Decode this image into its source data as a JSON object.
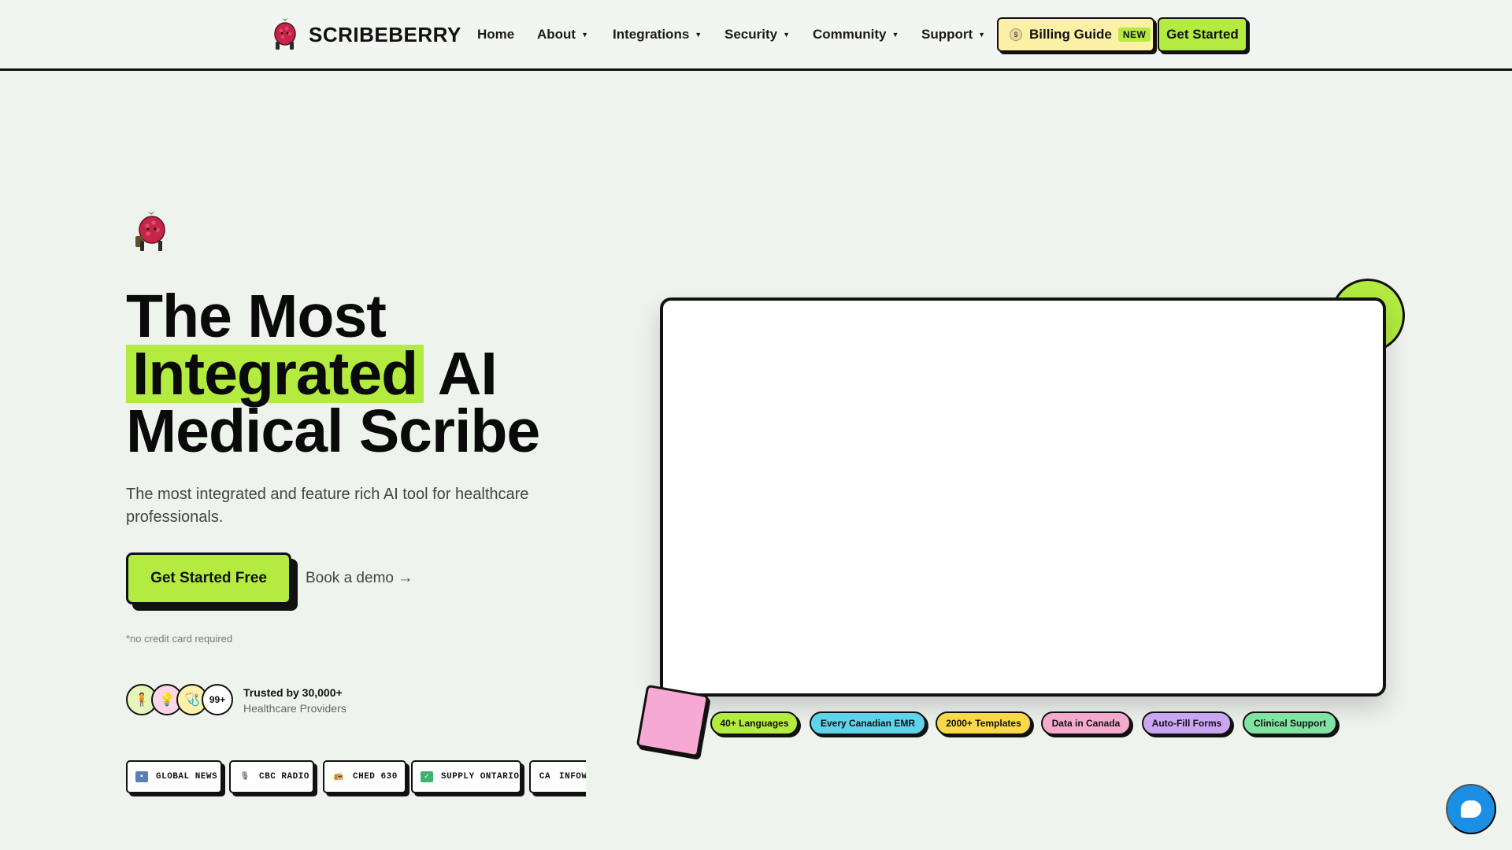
{
  "nav": {
    "brand": "SCRIBEBERRY",
    "links": [
      {
        "label": "Home",
        "caret": false
      },
      {
        "label": "About",
        "caret": true
      },
      {
        "label": "Integrations",
        "caret": true
      },
      {
        "label": "Security",
        "caret": true
      },
      {
        "label": "Community",
        "caret": true
      },
      {
        "label": "Support",
        "caret": true
      }
    ],
    "caret_glyph": "▼",
    "billing_label": "Billing Guide",
    "billing_badge": "NEW",
    "get_started": "Get Started"
  },
  "hero": {
    "headline_line1": "The Most",
    "headline_highlight": "Integrated",
    "headline_line2_rest": "AI",
    "headline_line3": "Medical Scribe",
    "subtitle": "The most integrated and feature rich AI tool for healthcare professionals.",
    "cta_primary": "Get Started Free",
    "cta_secondary": "Book a demo →",
    "note": "*no credit card required",
    "trusted_title": "Trusted by 30,000+",
    "trusted_subtitle": "Healthcare Providers",
    "avatar_count": "99+"
  },
  "press": [
    {
      "label": "GLOBAL NEWS",
      "icon": "tv-icon"
    },
    {
      "label": "CBC RADIO",
      "icon": "microphone-icon"
    },
    {
      "label": "CHED 630",
      "icon": "radio-icon"
    },
    {
      "label": "SUPPLY ONTARIO",
      "icon": "check-icon"
    },
    {
      "label": "INFOWA",
      "icon": "ca-flag-icon",
      "prefix": "CA"
    }
  ],
  "tags": [
    {
      "label": "40+ Languages",
      "color": "#b3eb41"
    },
    {
      "label": "Every Canadian EMR",
      "color": "#5ed3ea"
    },
    {
      "label": "2000+ Templates",
      "color": "#f9d84a"
    },
    {
      "label": "Data in Canada",
      "color": "#f5a9cd"
    },
    {
      "label": "Auto-Fill Forms",
      "color": "#c9a6f2"
    },
    {
      "label": "Clinical Support",
      "color": "#7fe3a2"
    }
  ],
  "colors": {
    "accent_green": "#b3eb41",
    "billing_yellow": "#fdf1a6",
    "chat_blue": "#1a8fe3",
    "deco_pink": "#f5a9d3"
  }
}
